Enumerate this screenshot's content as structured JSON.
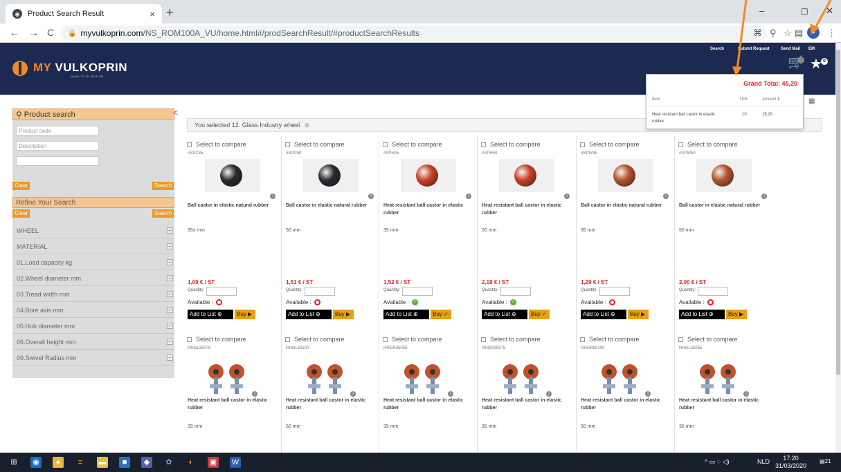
{
  "browser": {
    "tab_title": "Product Search Result",
    "tab_close": "×",
    "new_tab": "+",
    "url_domain": "myvulkoprin.com",
    "url_path": "/NS_ROM100A_VU/home.html#/prodSearchResult/#productSearchResults",
    "back": "←",
    "forward": "→",
    "reload": "C",
    "win_min": "–",
    "win_max": "◻",
    "win_close": "✕"
  },
  "header": {
    "logo_my": "MY",
    "logo_name": "VULKOPRIN",
    "logo_tag": "QUALITY IN MOTION",
    "links": [
      "Search",
      "Submit Request",
      "Send Mail",
      "EM"
    ],
    "cart_count": "",
    "fav_count": "0"
  },
  "sidebar": {
    "title": "Product search",
    "collapse": "<",
    "product_code_placeholder": "Product code",
    "description_placeholder": "Description",
    "clear_label": "Clear",
    "search_label": "Search",
    "refine_title": "Refine Your Search",
    "facets": [
      "WHEEL",
      "MATERIAL",
      "01.Load capacity kg",
      "02.Wheel diameter mm",
      "03.Tread width mm",
      "04.Bore axis mm",
      "05.Hub diameter mm",
      "06.Overall height mm",
      "09.Swivel Radius mm"
    ]
  },
  "selection": {
    "text": "You selected  12. Glass Industry wheel",
    "remove_icon": "⊗"
  },
  "compare_label": "Select to compare",
  "quantity_label": "Quantity:",
  "available_label": "Available :",
  "add_to_list_label": "Add to List",
  "buy_label": "Buy",
  "products_row1": [
    {
      "code": "#SPC35",
      "name": "Ball castor in elastic natural rubber",
      "size": "35x mm",
      "price": "1,09 € / ST",
      "available": false,
      "color": "#2a2a2e"
    },
    {
      "code": "#SPC50",
      "name": "Ball castor in elastic natural rubber",
      "size": "50 mm",
      "price": "1,51 € / ST",
      "available": false,
      "color": "#2a2a2e"
    },
    {
      "code": "#SPH35",
      "name": "Heat resistant ball castor in elastic rubber",
      "size": "35 mm",
      "price": "1,52 € / ST",
      "available": true,
      "color": "#c8412a"
    },
    {
      "code": "#SPH50",
      "name": "Heat resistant ball castor in elastic rubber",
      "size": "50 mm",
      "price": "2,18 € / ST",
      "available": true,
      "color": "#c8412a"
    },
    {
      "code": "#SPW35",
      "name": "Ball castor in elastic natural rubber",
      "size": "35 mm",
      "price": "1,29 € / ST",
      "available": false,
      "color": "#b5532e"
    },
    {
      "code": "#SPW50",
      "name": "Ball castor in elastic natural rubber",
      "size": "50 mm",
      "price": "2,00 € / ST",
      "available": false,
      "color": "#b5532e"
    }
  ],
  "products_row2": [
    {
      "code": "RHGL35075",
      "name": "Heat resistant ball castor in elastic rubber",
      "size": "35 mm"
    },
    {
      "code": "RHGL50100",
      "name": "Heat resistant ball castor in elastic rubber",
      "size": "50 mm"
    },
    {
      "code": "RHGR35055",
      "name": "Heat resistant ball castor in elastic rubber",
      "size": "35 mm"
    },
    {
      "code": "RHGR35075",
      "name": "Heat resistant ball castor in elastic rubber",
      "size": "35 mm"
    },
    {
      "code": "RHGR50100",
      "name": "Heat resistant ball castor in elastic rubber",
      "size": "50 mm"
    },
    {
      "code": "RHGL35055",
      "name": "Heat resistant ball castor in elastic rubber",
      "size": "35 mm"
    }
  ],
  "cart_popup": {
    "grand_total": "Grand Total:  45,20",
    "col_item": "Item",
    "col_unit": "Unit",
    "col_amount": "Amount €",
    "row_item": "Heat resistant ball castor in elastic rubber",
    "row_unit": "10",
    "row_amount": "15,20"
  },
  "taskbar": {
    "lang": "NLD",
    "time": "17:20",
    "date": "31/03/2020",
    "notif": "21"
  },
  "colors": {
    "header": "#1c2a52",
    "accent": "#f28b24",
    "price": "#e0242a"
  }
}
